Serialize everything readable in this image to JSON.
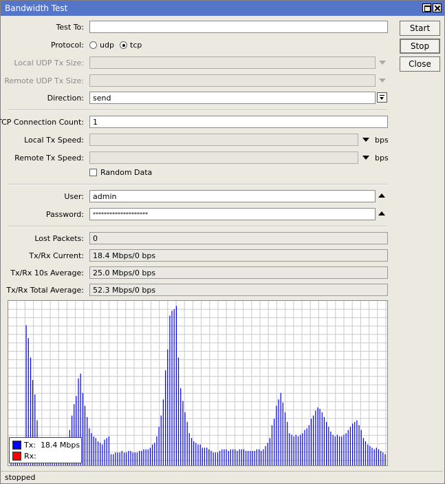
{
  "window": {
    "title": "Bandwidth Test"
  },
  "buttons": {
    "start": "Start",
    "stop": "Stop",
    "close": "Close"
  },
  "form": {
    "test_to": {
      "label": "Test To:",
      "value": ""
    },
    "protocol": {
      "label": "Protocol:",
      "options": [
        "udp",
        "tcp"
      ],
      "selected": "tcp"
    },
    "local_udp_tx_size": {
      "label": "Local UDP Tx Size:",
      "value": ""
    },
    "remote_udp_tx_size": {
      "label": "Remote UDP Tx Size:",
      "value": ""
    },
    "direction": {
      "label": "Direction:",
      "value": "send"
    },
    "tcp_connection_count": {
      "label": "TCP Connection Count:",
      "value": "1"
    },
    "local_tx_speed": {
      "label": "Local Tx Speed:",
      "value": "",
      "unit": "bps"
    },
    "remote_tx_speed": {
      "label": "Remote Tx Speed:",
      "value": "",
      "unit": "bps"
    },
    "random_data": {
      "label": "Random Data",
      "checked": false
    },
    "user": {
      "label": "User:",
      "value": "admin"
    },
    "password": {
      "label": "Password:",
      "value": "********************"
    }
  },
  "stats": {
    "lost_packets": {
      "label": "Lost Packets:",
      "value": "0"
    },
    "txrx_current": {
      "label": "Tx/Rx Current:",
      "value": "18.4 Mbps/0 bps"
    },
    "txrx_10s_avg": {
      "label": "Tx/Rx 10s Average:",
      "value": "25.0 Mbps/0 bps"
    },
    "txrx_total_avg": {
      "label": "Tx/Rx Total Average:",
      "value": "52.3 Mbps/0 bps"
    }
  },
  "legend": {
    "tx_label": "Tx:",
    "tx_value": "18.4 Mbps",
    "tx_color": "#0000ff",
    "rx_label": "Rx:",
    "rx_value": "",
    "rx_color": "#ff0000"
  },
  "chart_data": {
    "type": "bar",
    "series": [
      {
        "name": "Tx",
        "color": "#0000ff",
        "values": [
          0.02,
          0.04,
          0.06,
          0.05,
          0.08,
          0.08,
          0.12,
          0.87,
          0.79,
          0.67,
          0.53,
          0.44,
          0.28,
          0.15,
          0.1,
          0.09,
          0.09,
          0.08,
          0.09,
          0.08,
          0.08,
          0.08,
          0.07,
          0.1,
          0.11,
          0.12,
          0.14,
          0.22,
          0.31,
          0.38,
          0.43,
          0.54,
          0.57,
          0.45,
          0.37,
          0.3,
          0.23,
          0.2,
          0.18,
          0.17,
          0.15,
          0.14,
          0.13,
          0.16,
          0.17,
          0.18,
          0.07,
          0.07,
          0.08,
          0.08,
          0.08,
          0.09,
          0.08,
          0.08,
          0.09,
          0.09,
          0.08,
          0.08,
          0.08,
          0.09,
          0.09,
          0.1,
          0.1,
          0.1,
          0.11,
          0.13,
          0.14,
          0.18,
          0.24,
          0.31,
          0.41,
          0.59,
          0.72,
          0.93,
          0.96,
          0.97,
          0.99,
          0.67,
          0.48,
          0.4,
          0.33,
          0.27,
          0.2,
          0.17,
          0.15,
          0.14,
          0.13,
          0.13,
          0.11,
          0.11,
          0.11,
          0.1,
          0.09,
          0.08,
          0.08,
          0.08,
          0.09,
          0.1,
          0.1,
          0.1,
          0.09,
          0.1,
          0.1,
          0.1,
          0.09,
          0.1,
          0.1,
          0.1,
          0.09,
          0.09,
          0.09,
          0.09,
          0.09,
          0.1,
          0.1,
          0.09,
          0.1,
          0.12,
          0.14,
          0.17,
          0.25,
          0.29,
          0.37,
          0.41,
          0.45,
          0.39,
          0.33,
          0.27,
          0.2,
          0.19,
          0.18,
          0.19,
          0.18,
          0.19,
          0.2,
          0.22,
          0.23,
          0.25,
          0.29,
          0.31,
          0.34,
          0.36,
          0.35,
          0.33,
          0.3,
          0.27,
          0.24,
          0.21,
          0.19,
          0.18,
          0.19,
          0.18,
          0.18,
          0.19,
          0.2,
          0.22,
          0.24,
          0.26,
          0.27,
          0.28,
          0.25,
          0.22,
          0.17,
          0.15,
          0.13,
          0.12,
          0.11,
          0.1,
          0.11,
          0.1,
          0.09,
          0.08,
          0.07
        ]
      },
      {
        "name": "Rx",
        "color": "#ff0000",
        "values": []
      }
    ],
    "ylim": [
      0,
      1
    ],
    "grid": true
  },
  "status": {
    "text": "stopped"
  }
}
